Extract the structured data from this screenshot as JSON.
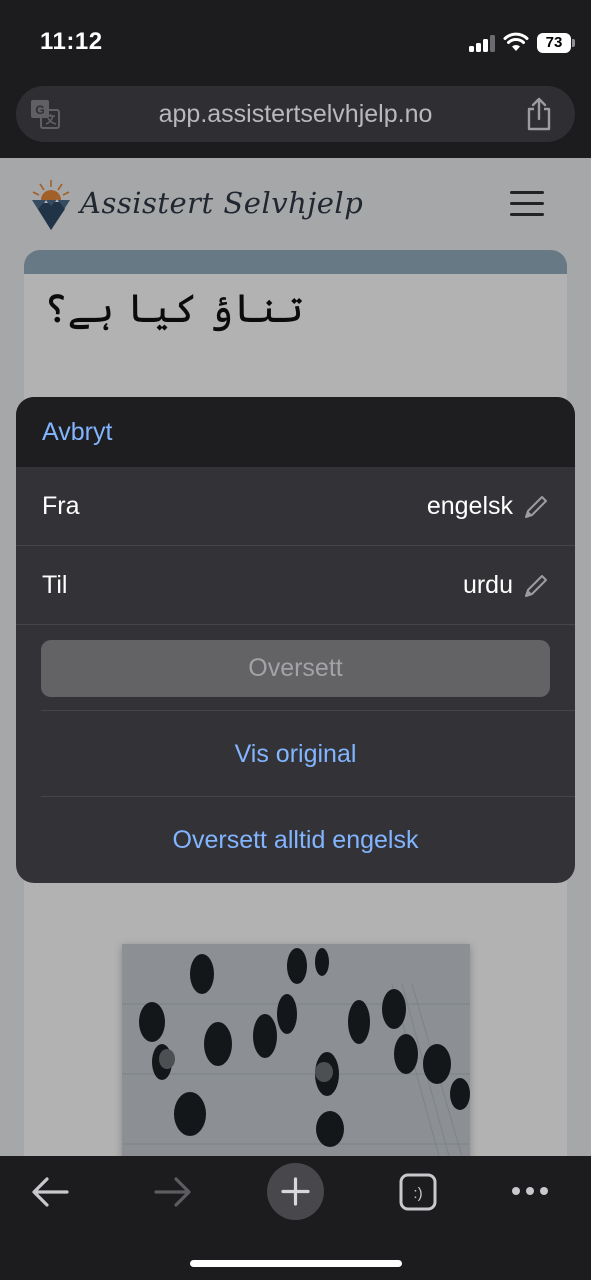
{
  "status_bar": {
    "time": "11:12",
    "battery": "73"
  },
  "address_bar": {
    "url": "app.assistertselvhjelp.no"
  },
  "site": {
    "logo_text": "Assistert Selvhjelp",
    "heading": "تناؤ کیا ہے؟",
    "body_snippet": "...",
    "colors": {
      "card_band": "#94aebf"
    }
  },
  "translate_sheet": {
    "cancel_label": "Avbryt",
    "from_label": "Fra",
    "from_value": "engelsk",
    "to_label": "Til",
    "to_value": "urdu",
    "translate_button": "Oversett",
    "show_original": "Vis original",
    "always_translate": "Oversett alltid engelsk",
    "colors": {
      "accent": "#82b4ff",
      "sheet_bg": "#333337"
    }
  },
  "toolbar": {
    "icons": [
      "back-arrow-icon",
      "forward-arrow-icon",
      "new-tab-plus-icon",
      "tabs-icon",
      "more-icon"
    ]
  }
}
